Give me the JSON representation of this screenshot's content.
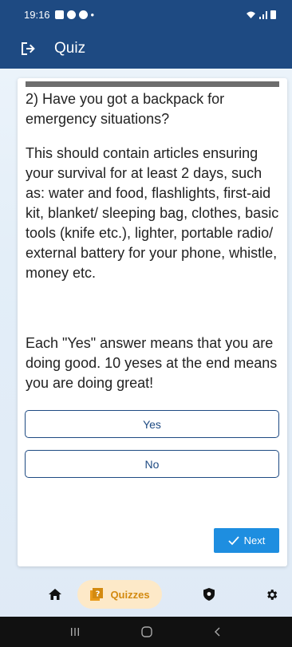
{
  "status_bar": {
    "time": "19:16",
    "dot": "•"
  },
  "app_bar": {
    "title": "Quiz",
    "logout_icon": "logout-icon"
  },
  "quiz": {
    "progress_fraction": 1.0,
    "question": "2) Have you got a backpack for emergency situations?",
    "description": "This should contain articles ensuring your survival for at least 2 days, such as: water and food, flashlights, first-aid kit, blanket/ sleeping bag, clothes, basic tools (knife etc.), lighter, portable radio/ external battery for your phone, whistle, money etc.",
    "note": "Each \"Yes\" answer means that you are doing good. 10 yeses at the end means you are doing great!",
    "answers": [
      {
        "label": "Yes"
      },
      {
        "label": "No"
      }
    ],
    "next_label": "Next"
  },
  "bottom_nav": {
    "items": [
      {
        "icon": "home-icon"
      },
      {
        "icon": "quiz-icon",
        "label": "Quizzes",
        "active": true
      },
      {
        "icon": "shield-icon"
      },
      {
        "icon": "gear-icon"
      }
    ]
  },
  "colors": {
    "primary": "#1e4a82",
    "accent": "#1e8ee0",
    "active_nav_bg": "#fde9c8",
    "active_nav_fg": "#d38a10"
  }
}
